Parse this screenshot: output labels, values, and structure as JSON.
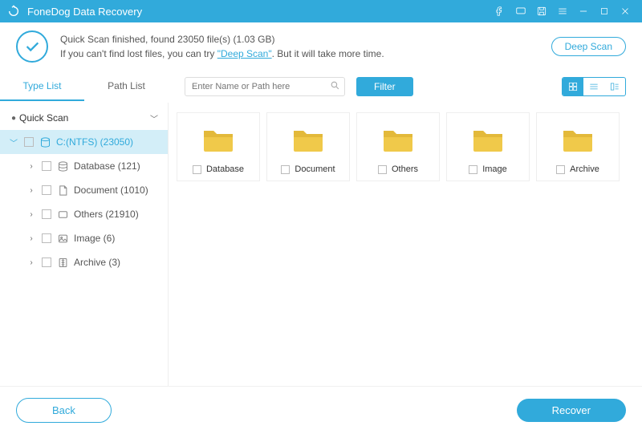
{
  "app": {
    "title": "FoneDog Data Recovery"
  },
  "status": {
    "line1_a": "Quick Scan finished, found ",
    "line1_count": "23050",
    "line1_b": " file(s) (",
    "line1_size": "1.03 GB",
    "line1_c": ")",
    "line2_a": "If you can't find lost files, you can try ",
    "deep_link": "\"Deep Scan\"",
    "line2_b": ". But it will take more time.",
    "deep_scan_btn": "Deep Scan"
  },
  "tabs": {
    "type": "Type List",
    "path": "Path List"
  },
  "search": {
    "placeholder": "Enter Name or Path here"
  },
  "filter": "Filter",
  "tree": {
    "root": "Quick Scan",
    "drive": "C:(NTFS) (23050)",
    "items": [
      {
        "label": "Database (121)"
      },
      {
        "label": "Document (1010)"
      },
      {
        "label": "Others (21910)"
      },
      {
        "label": "Image (6)"
      },
      {
        "label": "Archive (3)"
      }
    ]
  },
  "folders": [
    {
      "name": "Database"
    },
    {
      "name": "Document"
    },
    {
      "name": "Others"
    },
    {
      "name": "Image"
    },
    {
      "name": "Archive"
    }
  ],
  "footer": {
    "back": "Back",
    "recover": "Recover"
  }
}
